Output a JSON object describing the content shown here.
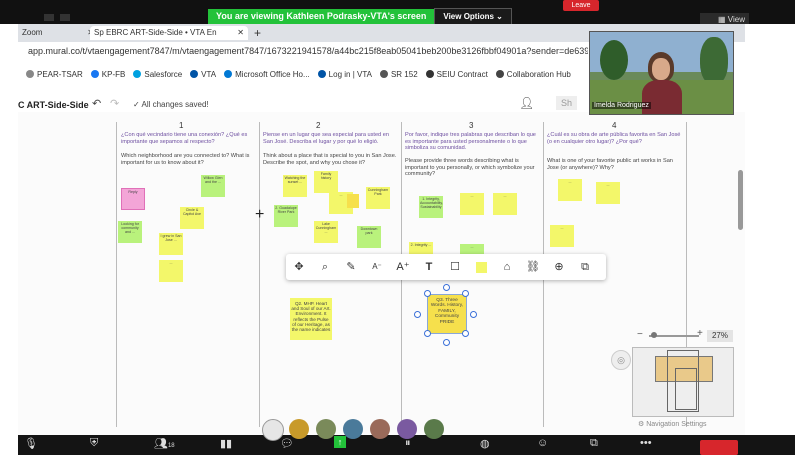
{
  "zoom": {
    "banner_message": "You are viewing Kathleen Podrasky-VTA's screen",
    "view_options_label": "View Options",
    "leave_label": "Leave",
    "view_label": "View",
    "participant_count": "18",
    "participant_name": "Imelda Rodriguez"
  },
  "browser": {
    "tabs": [
      {
        "label": "Zoom"
      },
      {
        "label": "Sp EBRC ART-Side-Side • VTA En"
      }
    ],
    "new_tab": "+",
    "url": "app.mural.co/t/vtaengagement7847/m/vtaengagement7847/1673221941578/a44bc215f8eab05041beb200be3126fbbf04901a?sender=de63985",
    "bookmarks": [
      {
        "label": "PEAR-TSAR",
        "color": "#888888"
      },
      {
        "label": "KP-FB",
        "color": "#1877f2"
      },
      {
        "label": "Salesforce",
        "color": "#00a1e0"
      },
      {
        "label": "VTA",
        "color": "#0054a6"
      },
      {
        "label": "Microsoft Office Ho...",
        "color": "#0078d4"
      },
      {
        "label": "Log in | VTA",
        "color": "#0054a6"
      },
      {
        "label": "SR 152",
        "color": "#555555"
      },
      {
        "label": "SEIU Contract",
        "color": "#333333"
      },
      {
        "label": "Collaboration Hub",
        "color": "#444444"
      }
    ]
  },
  "mural": {
    "board_title": "C ART-Side-Side",
    "saved_status": "All changes saved!",
    "share_label": "Sh",
    "column_numbers": [
      "1",
      "2",
      "3",
      "4"
    ],
    "questions": [
      {
        "es": "¿Con qué vecindario tiene una conexión? ¿Qué es importante que sepamos al respecto?",
        "en": "Which neighborhood are you connected to? What is important for us to know about it?"
      },
      {
        "es": "Piense en un lugar que sea especial para usted en San José. Describa el lugar y por qué lo eligió.",
        "en": "Think about a place that is special to you in San Jose. Describe the spot, and why you chose it?"
      },
      {
        "es": "Por favor, indique tres palabras que describan lo que es importante para usted personalmente o lo que simboliza su comunidad.",
        "en": "Please provide three words describing what is important to you personally, or which symbolize your community?"
      },
      {
        "es": "¿Cuál es su obra de arte pública favorita en San José (o en cualquier otro lugar)? ¿Por qué?",
        "en": "What is one of your favorite public art works in San Jose (or anywhere)? Why?"
      }
    ],
    "notes": {
      "col1_pink": "Reply",
      "col1_a": "Willow Glen and the ...",
      "col1_b": "Circle & Capitol Ave",
      "col1_c": "Looking for community and ...",
      "col1_d": "I grew in San Jose ...",
      "col1_e": "...",
      "col2_a": "Watching the sunset ...",
      "col2_b": "Family history",
      "col2_c": "Cunningham Park",
      "col2_d": "2. Guadalupe River Park",
      "col2_e": "Lake Cunningham ...",
      "col2_f": "...",
      "col2_g": "Downtown park",
      "col2_main": "Q2. MHP. Heart and Soul of our Art. Environment. It reflects the Pulse of our Heritage, as the name indicates",
      "col3_a": "1. Integrity, Accountability, Sustainability",
      "col3_b": "... ",
      "col3_c": "... ",
      "col3_d": "2. Integrity ...",
      "col3_e": "...",
      "col3_selected": "Q3. Three Words. History, FAMILY, Community PRIDE",
      "col4_a": "...",
      "col4_b": "...",
      "col4_c": "..."
    },
    "zoom_level": "27%",
    "nav_settings_label": "Navigation Settings"
  },
  "colors": {
    "sticky_yellow": "#f3f76a",
    "sticky_green": "#b9f27c",
    "sticky_pink": "#f3a5d7",
    "zoom_green": "#23c23a",
    "leave_red": "#d7262c",
    "question_purple": "#6d4ea0"
  }
}
